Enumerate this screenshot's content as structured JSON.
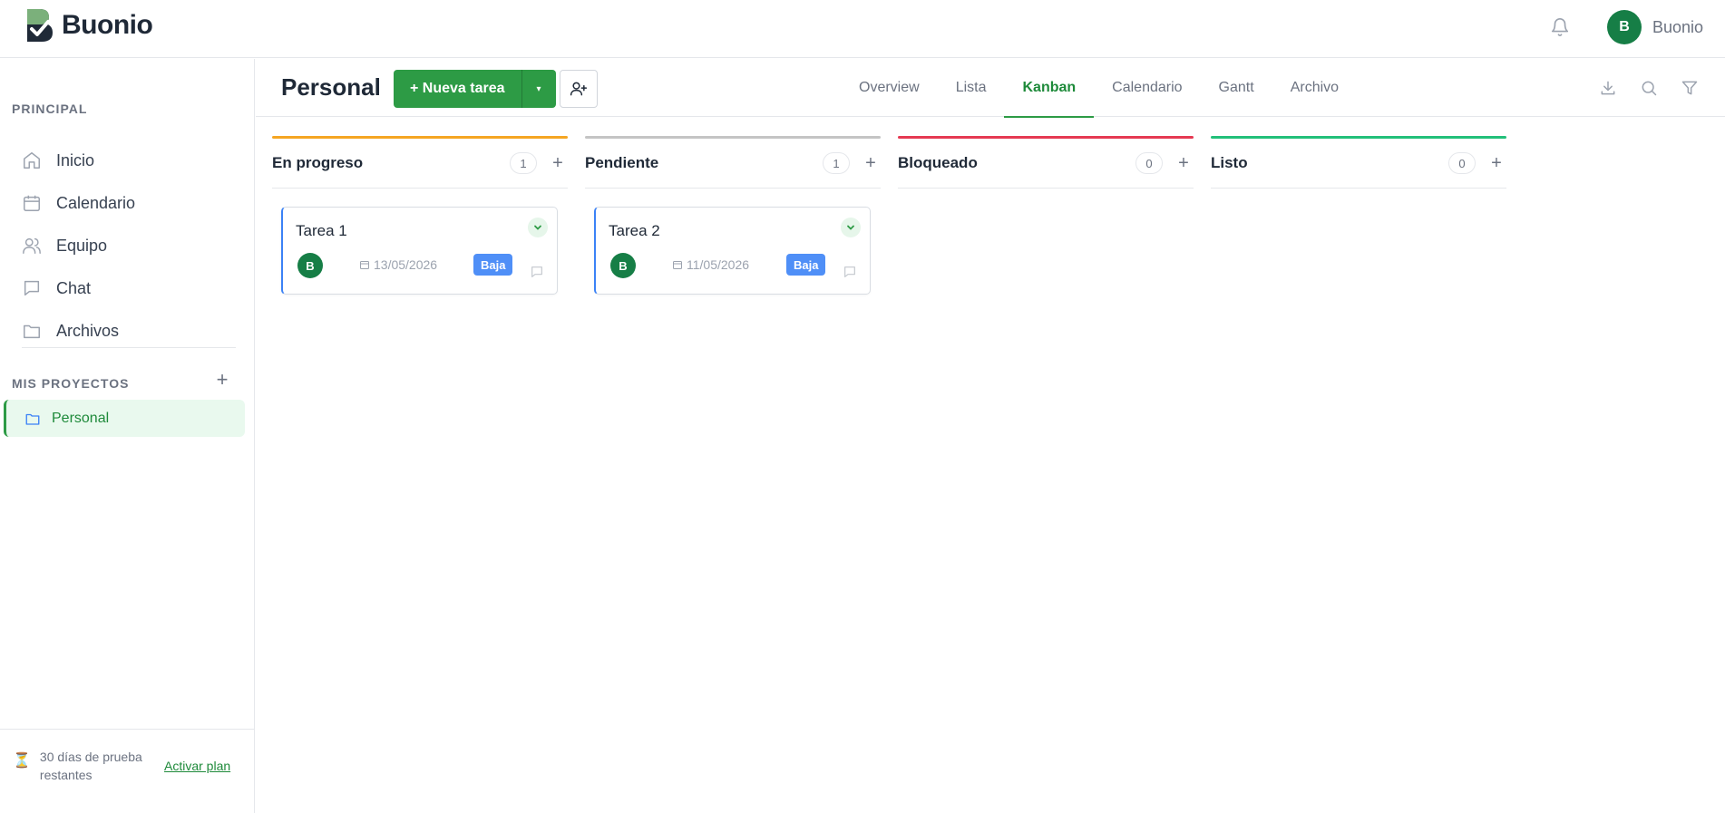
{
  "app": {
    "name": "Buonio"
  },
  "topbar": {
    "user_initial": "B",
    "user_name": "Buonio"
  },
  "sidebar": {
    "section_principal": "PRINCIPAL",
    "items": [
      {
        "label": "Inicio",
        "icon": "home-icon"
      },
      {
        "label": "Calendario",
        "icon": "calendar-icon"
      },
      {
        "label": "Equipo",
        "icon": "users-icon"
      },
      {
        "label": "Chat",
        "icon": "chat-icon"
      },
      {
        "label": "Archivos",
        "icon": "folder-icon"
      }
    ],
    "section_projects": "MIS PROYECTOS",
    "add_project": "+",
    "projects": [
      {
        "label": "Personal",
        "active": true
      }
    ],
    "trial_text": "30 días de prueba restantes",
    "activate_label": "Activar plan"
  },
  "header": {
    "title": "Personal",
    "new_task_label": "+ Nueva tarea",
    "caret": "▾",
    "tabs": [
      {
        "label": "Overview",
        "active": false
      },
      {
        "label": "Lista",
        "active": false
      },
      {
        "label": "Kanban",
        "active": true
      },
      {
        "label": "Calendario",
        "active": false
      },
      {
        "label": "Gantt",
        "active": false
      },
      {
        "label": "Archivo",
        "active": false
      }
    ]
  },
  "colors": {
    "accent": "#2d9b45",
    "column_en_progreso": "#f5a623",
    "column_pendiente": "#c4c4c4",
    "column_bloqueado": "#e53952",
    "column_listo": "#22c07a",
    "priority_baja": "#4f8ff7"
  },
  "kanban": {
    "columns": [
      {
        "title": "En progreso",
        "count": "1",
        "add": "+",
        "cards": [
          {
            "title": "Tarea 1",
            "assignee": "B",
            "date": "13/05/2026",
            "priority": "Baja"
          }
        ]
      },
      {
        "title": "Pendiente",
        "count": "1",
        "add": "+",
        "cards": [
          {
            "title": "Tarea 2",
            "assignee": "B",
            "date": "11/05/2026",
            "priority": "Baja"
          }
        ]
      },
      {
        "title": "Bloqueado",
        "count": "0",
        "add": "+",
        "cards": []
      },
      {
        "title": "Listo",
        "count": "0",
        "add": "+",
        "cards": []
      }
    ]
  }
}
